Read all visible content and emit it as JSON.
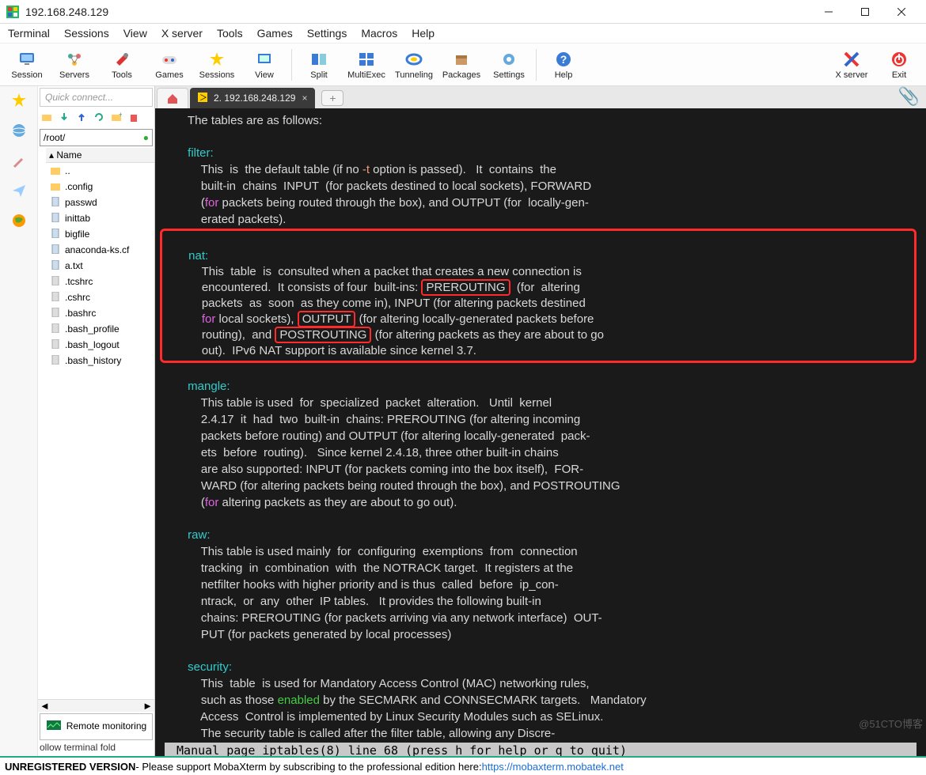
{
  "window": {
    "title": "192.168.248.129"
  },
  "menus": [
    "Terminal",
    "Sessions",
    "View",
    "X server",
    "Tools",
    "Games",
    "Settings",
    "Macros",
    "Help"
  ],
  "toolbar": [
    {
      "label": "Session",
      "icon": "monitor"
    },
    {
      "label": "Servers",
      "icon": "servers"
    },
    {
      "label": "Tools",
      "icon": "tools"
    },
    {
      "label": "Games",
      "icon": "games"
    },
    {
      "label": "Sessions",
      "icon": "star"
    },
    {
      "label": "View",
      "icon": "view"
    },
    {
      "label": "Split",
      "icon": "split"
    },
    {
      "label": "MultiExec",
      "icon": "multi"
    },
    {
      "label": "Tunneling",
      "icon": "tunnel"
    },
    {
      "label": "Packages",
      "icon": "pkg"
    },
    {
      "label": "Settings",
      "icon": "gear"
    },
    {
      "label": "Help",
      "icon": "help"
    }
  ],
  "toolbar_right": [
    {
      "label": "X server",
      "icon": "xserver"
    },
    {
      "label": "Exit",
      "icon": "exit"
    }
  ],
  "sidebar": {
    "quick_placeholder": "Quick connect...",
    "path": "/root/",
    "header": "Name",
    "files": [
      "..",
      ".config",
      "passwd",
      "inittab",
      "bigfile",
      "anaconda-ks.cf",
      "a.txt",
      ".tcshrc",
      ".cshrc",
      ".bashrc",
      ".bash_profile",
      ".bash_logout",
      ".bash_history"
    ],
    "remote_label": "Remote monitoring",
    "follow": "ollow terminal fold"
  },
  "tabs": {
    "active_label": "2. 192.168.248.129"
  },
  "terminal": {
    "l1": "       The tables are as follows:",
    "filter_h": "       filter:",
    "filter_1": "           This  is  the default table (if no ",
    "filter_1b": "-t",
    "filter_1c": " option is passed).   It  contains  the",
    "filter_2": "           built-in  chains  INPUT  (for packets destined to local sockets), FORWARD",
    "filter_3a": "           (",
    "filter_3for": "for",
    "filter_3b": " packets being routed through the box), and OUTPUT (for  locally-gen-",
    "filter_4": "           erated packets).",
    "nat_h": "       nat:",
    "nat_1": "           This  table  is  consulted when a packet that creates a new connection is",
    "nat_2": "           encountered.  It consists of four  built-ins: ",
    "nat_prer": "PREROUTING",
    "nat_2b": "  (for  altering",
    "nat_3": "           packets  as  soon  as they come in), INPUT (for altering packets destined",
    "nat_4a": "           ",
    "nat_4for": "for",
    "nat_4b": " local sockets), ",
    "nat_out": "OUTPUT",
    "nat_4c": " (for altering locally-generated packets before",
    "nat_5a": "           routing),  and ",
    "nat_post": "POSTROUTING",
    "nat_5b": " (for altering packets as they are about to go",
    "nat_6": "           out).  IPv6 NAT support is available since kernel 3.7.",
    "mangle_h": "       mangle:",
    "m1": "           This table is used  for  specialized  packet  alteration.   Until  kernel",
    "m2": "           2.4.17  it  had  two  built-in  chains: PREROUTING (for altering incoming",
    "m3": "           packets before routing) and OUTPUT (for altering locally-generated  pack-",
    "m4": "           ets  before  routing).   Since kernel 2.4.18, three other built-in chains",
    "m5": "           are also supported: INPUT (for packets coming into the box itself),  FOR-",
    "m6": "           WARD (for altering packets being routed through the box), and POSTROUTING",
    "m7a": "           (",
    "m7for": "for",
    "m7b": " altering packets as they are about to go out).",
    "raw_h": "       raw:",
    "r1": "           This table is used mainly  for  configuring  exemptions  from  connection",
    "r2": "           tracking  in  combination  with  the NOTRACK target.  It registers at the",
    "r3": "           netfilter hooks with higher priority and is thus  called  before  ip_con-",
    "r4": "           ntrack,  or  any  other  IP tables.   It provides the following built-in",
    "r5": "           chains: PREROUTING (for packets arriving via any network interface)  OUT-",
    "r6": "           PUT (for packets generated by local processes)",
    "sec_h": "       security:",
    "s1": "           This  table  is used for Mandatory Access Control (MAC) networking rules,",
    "s2a": "           such as those ",
    "s2en": "enabled",
    "s2b": " by the SECMARK and CONNSECMARK targets.   Mandatory",
    "s3": "           Access  Control is implemented by Linux Security Modules such as SELinux.",
    "s4": "           The security table is called after the filter table, allowing any Discre-",
    "status": " Manual page iptables(8) line 68 (press h for help or q to quit)"
  },
  "bottom": {
    "unreg": "UNREGISTERED VERSION",
    "msg": " -  Please support MobaXterm by subscribing to the professional edition here: ",
    "url": "https://mobaxterm.mobatek.net"
  },
  "watermark": "@51CTO博客"
}
